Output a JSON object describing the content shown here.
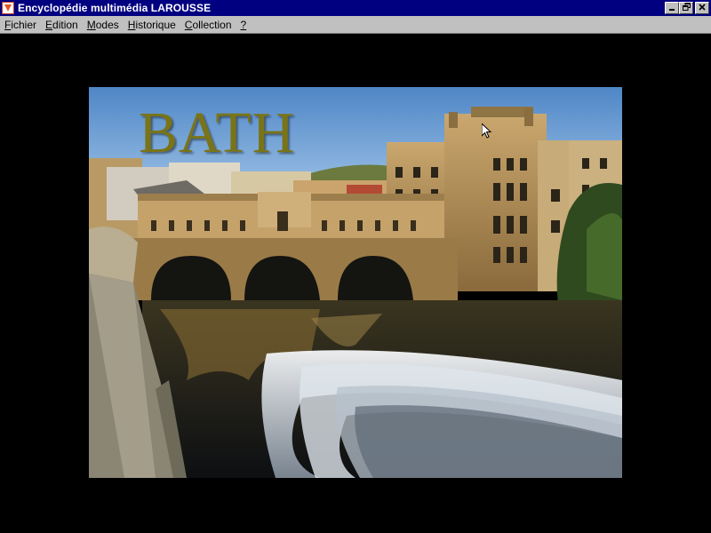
{
  "window": {
    "title": "Encyclopédie multimédia LAROUSSE",
    "app_icon": "larousse-icon",
    "buttons": {
      "minimize_icon": "minimize-icon",
      "restore_icon": "restore-icon",
      "close_icon": "close-icon"
    },
    "title_bar_color": "#000080"
  },
  "menu": {
    "items": [
      {
        "accel": "F",
        "rest": "ichier"
      },
      {
        "accel": "E",
        "rest": "dition"
      },
      {
        "accel": "M",
        "rest": "odes"
      },
      {
        "accel": "H",
        "rest": "istorique"
      },
      {
        "accel": "C",
        "rest": "ollection"
      },
      {
        "accel": "?",
        "rest": ""
      }
    ]
  },
  "content": {
    "photo_title": "BATH",
    "photo_title_color": "#7a7418",
    "background_color": "#000000"
  }
}
